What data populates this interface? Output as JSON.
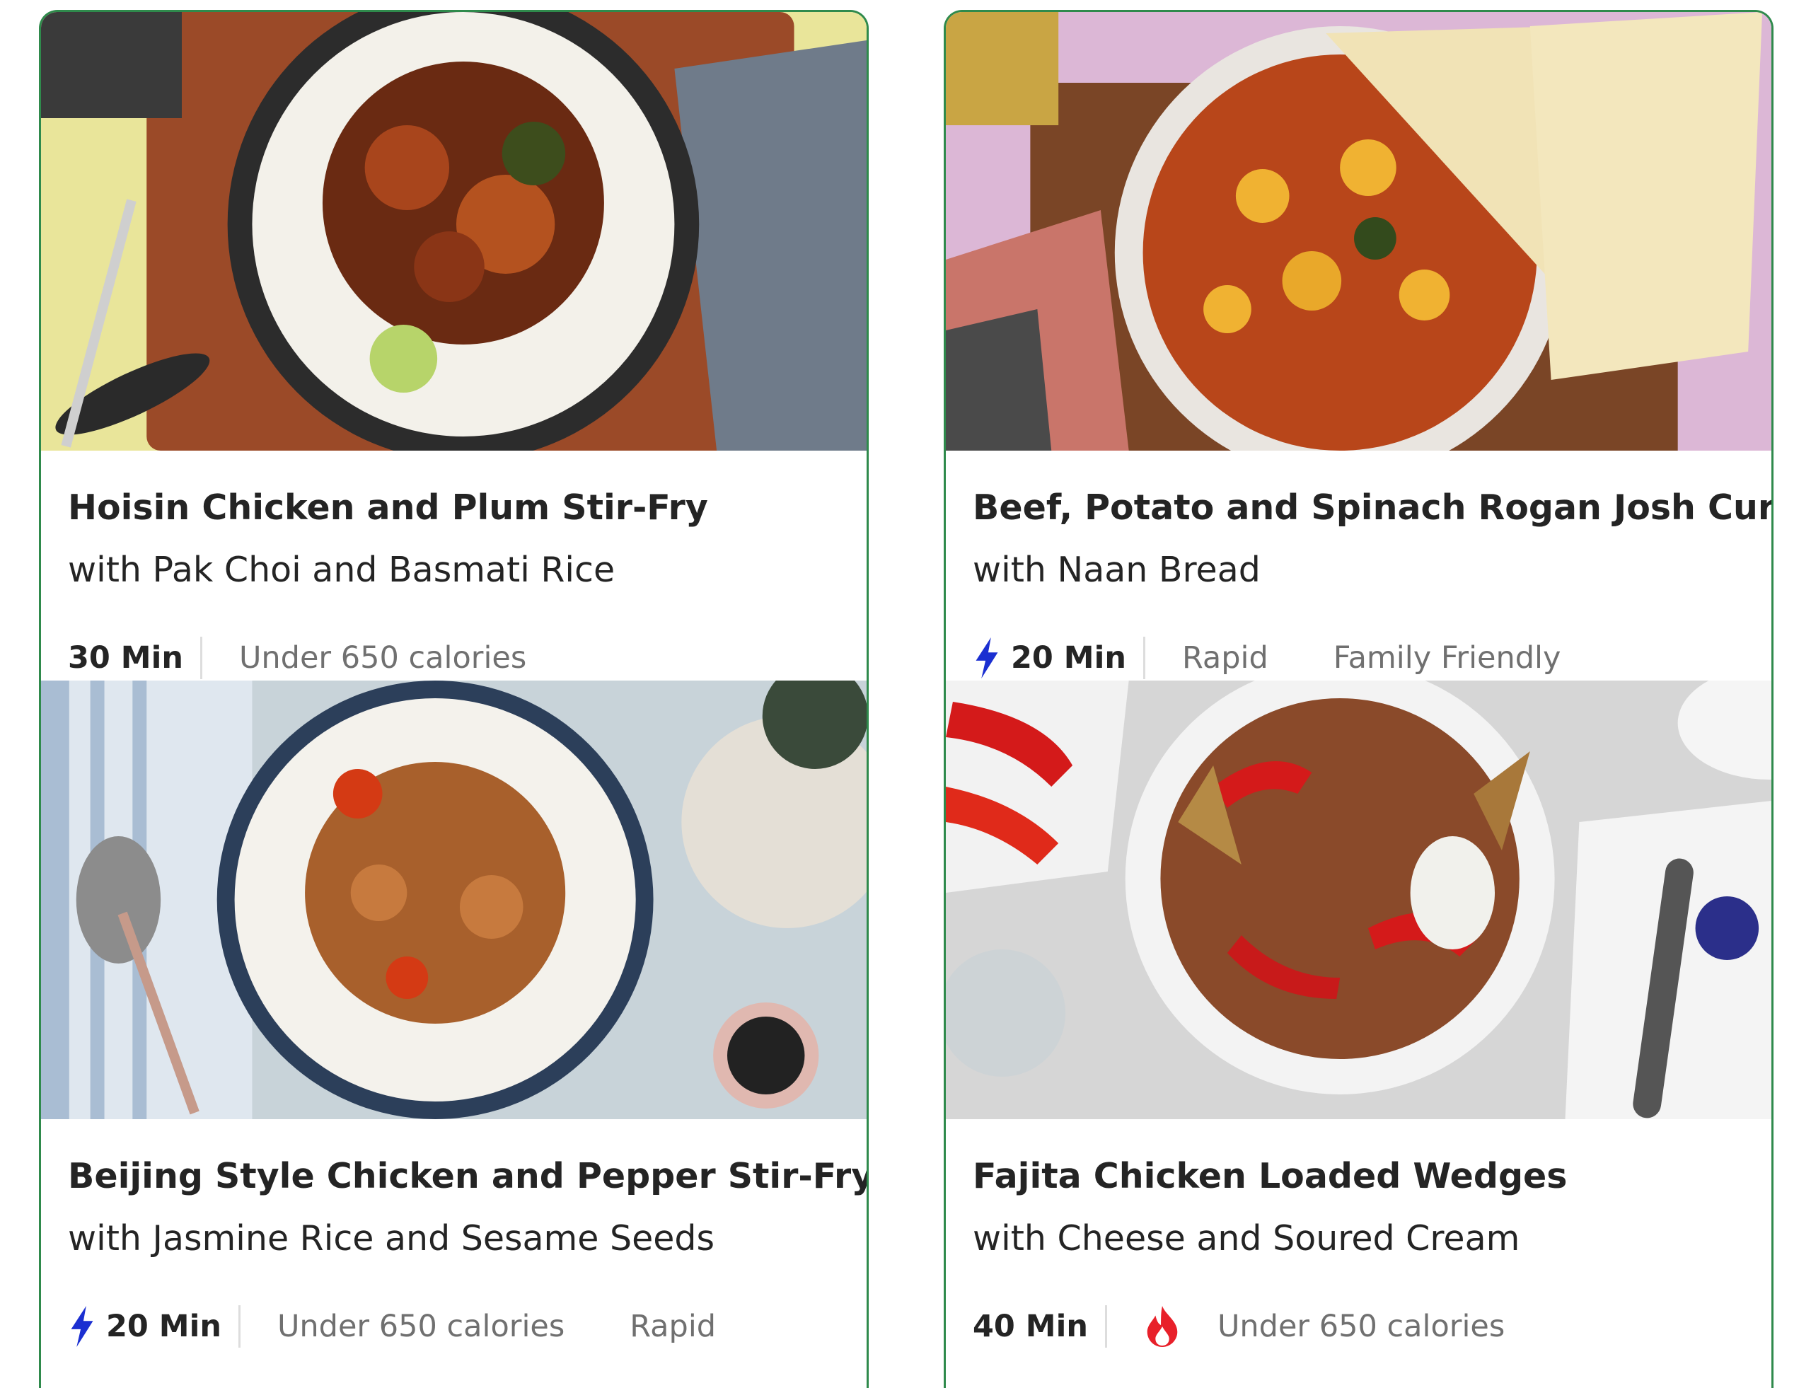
{
  "cards": [
    {
      "title": "Hoisin Chicken and Plum Stir-Fry",
      "subtitle": "with Pak Choi and Basmati Rice",
      "time": "30 Min",
      "tags": [
        "Under 650 calories"
      ]
    },
    {
      "title": "Beef, Potato and Spinach Rogan Josh Curry",
      "subtitle": "with Naan Bread",
      "time": "20 Min",
      "quick_icon": "lightning-bolt-icon",
      "tags": [
        "Rapid",
        "Family Friendly"
      ]
    },
    {
      "title": "Beijing Style Chicken and Pepper Stir-Fry",
      "subtitle": "with Jasmine Rice and Sesame Seeds",
      "time": "20 Min",
      "quick_icon": "lightning-bolt-icon",
      "tags": [
        "Under 650 calories",
        "Rapid"
      ]
    },
    {
      "title": "Fajita Chicken Loaded Wedges",
      "subtitle": "with Cheese and Soured Cream",
      "time": "40 Min",
      "spicy_icon": "flame-icon",
      "tags": [
        "Under 650 calories"
      ]
    }
  ],
  "colors": {
    "border": "#2f8a4c",
    "title": "#242424",
    "tag": "#707070",
    "bolt": "#1b2fd1",
    "flame": "#e8202a"
  }
}
